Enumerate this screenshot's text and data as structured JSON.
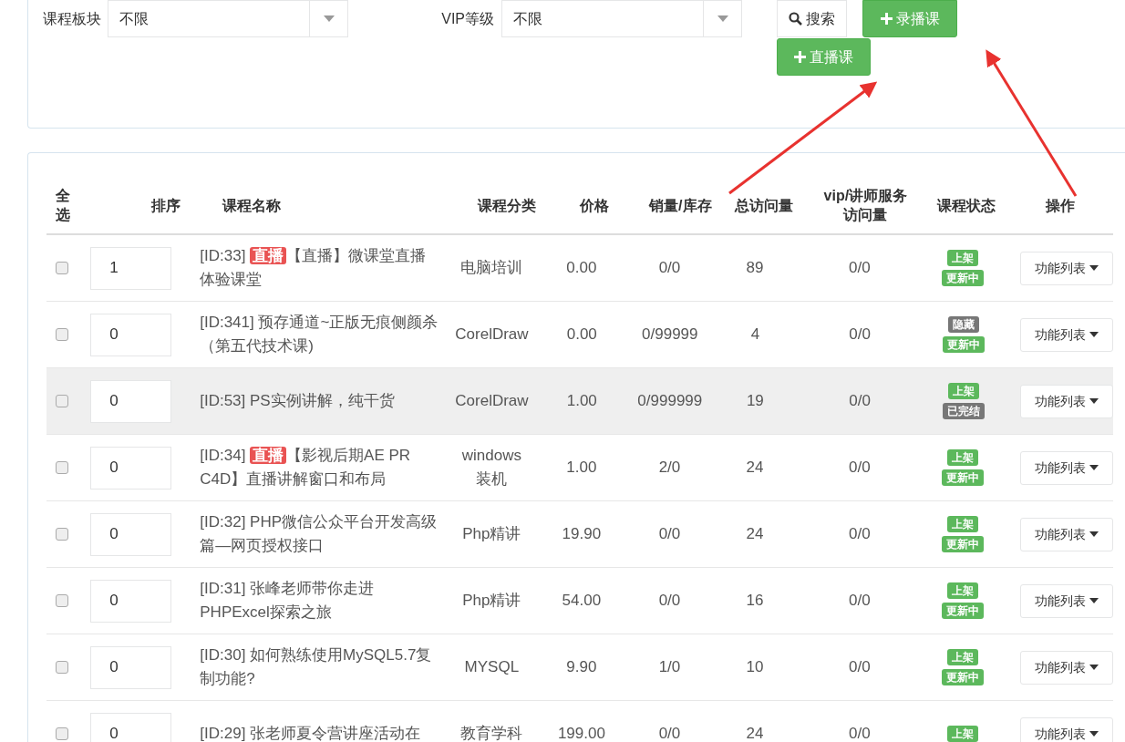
{
  "filters": [
    {
      "label": "课程板块",
      "value": "不限"
    },
    {
      "label": "VIP等级",
      "value": "不限"
    }
  ],
  "search_button": {
    "label": "搜索"
  },
  "add_recorded_button": {
    "label": "录播课"
  },
  "add_live_button": {
    "label": "直播课"
  },
  "table": {
    "columns": [
      "全选",
      "排序",
      "课程名称",
      "课程分类",
      "价格",
      "销量/库存",
      "总访问量",
      "vip/讲师服务访问量",
      "课程状态",
      "操作"
    ],
    "rows": [
      {
        "checked": false,
        "selected": false,
        "sort": "1",
        "id": "[ID:33]",
        "tag": "直播",
        "title": "【直播】微课堂直播体验课堂",
        "category": "电脑培训",
        "price": "0.00",
        "sales_stock": "0/0",
        "total_visits": "89",
        "vip_visits": "0/0",
        "badges": [
          {
            "label": "上架",
            "color": "#5cb85c"
          },
          {
            "label": "更新中",
            "color": "#5cb85c"
          }
        ],
        "action": "功能列表"
      },
      {
        "checked": false,
        "selected": false,
        "sort": "0",
        "id": "[ID:341]",
        "title": "预存通道~正版无痕侧颜杀（第五代技术课)",
        "category": "CorelDraw",
        "price": "0.00",
        "sales_stock": "0/99999",
        "total_visits": "4",
        "vip_visits": "0/0",
        "badges": [
          {
            "label": "隐藏",
            "color": "#777777"
          },
          {
            "label": "更新中",
            "color": "#5cb85c"
          }
        ],
        "action": "功能列表"
      },
      {
        "checked": false,
        "selected": true,
        "sort": "0",
        "id": "[ID:53]",
        "title": "PS实例讲解，纯干货",
        "category": "CorelDraw",
        "price": "1.00",
        "sales_stock": "0/999999",
        "total_visits": "19",
        "vip_visits": "0/0",
        "badges": [
          {
            "label": "上架",
            "color": "#5cb85c"
          },
          {
            "label": "已完结",
            "color": "#777777"
          }
        ],
        "action": "功能列表"
      },
      {
        "checked": false,
        "selected": false,
        "sort": "0",
        "id": "[ID:34]",
        "tag": "直播",
        "title": "【影视后期AE PR C4D】直播讲解窗口和布局",
        "category": "windows装机",
        "price": "1.00",
        "sales_stock": "2/0",
        "total_visits": "24",
        "vip_visits": "0/0",
        "badges": [
          {
            "label": "上架",
            "color": "#5cb85c"
          },
          {
            "label": "更新中",
            "color": "#5cb85c"
          }
        ],
        "action": "功能列表"
      },
      {
        "checked": false,
        "selected": false,
        "sort": "0",
        "id": "[ID:32]",
        "title": "PHP微信公众平台开发高级篇—网页授权接口",
        "category": "Php精讲",
        "price": "19.90",
        "sales_stock": "0/0",
        "total_visits": "24",
        "vip_visits": "0/0",
        "badges": [
          {
            "label": "上架",
            "color": "#5cb85c"
          },
          {
            "label": "更新中",
            "color": "#5cb85c"
          }
        ],
        "action": "功能列表"
      },
      {
        "checked": false,
        "selected": false,
        "sort": "0",
        "id": "[ID:31]",
        "title": "张峰老师带你走进PHPExcel探索之旅",
        "category": "Php精讲",
        "price": "54.00",
        "sales_stock": "0/0",
        "total_visits": "16",
        "vip_visits": "0/0",
        "badges": [
          {
            "label": "上架",
            "color": "#5cb85c"
          },
          {
            "label": "更新中",
            "color": "#5cb85c"
          }
        ],
        "action": "功能列表"
      },
      {
        "checked": false,
        "selected": false,
        "sort": "0",
        "id": "[ID:30]",
        "title": "如何熟练使用MySQL5.7复制功能?",
        "category": "MYSQL",
        "price": "9.90",
        "sales_stock": "1/0",
        "total_visits": "10",
        "vip_visits": "0/0",
        "badges": [
          {
            "label": "上架",
            "color": "#5cb85c"
          },
          {
            "label": "更新中",
            "color": "#5cb85c"
          }
        ],
        "action": "功能列表"
      },
      {
        "checked": false,
        "selected": false,
        "sort": "0",
        "id": "[ID:29]",
        "title": "张老师夏令营讲座活动在",
        "category": "教育学科",
        "price": "199.00",
        "sales_stock": "0/0",
        "total_visits": "24",
        "vip_visits": "0/0",
        "badges": [
          {
            "label": "上架",
            "color": "#5cb85c"
          }
        ],
        "action": "功能列表"
      }
    ]
  }
}
